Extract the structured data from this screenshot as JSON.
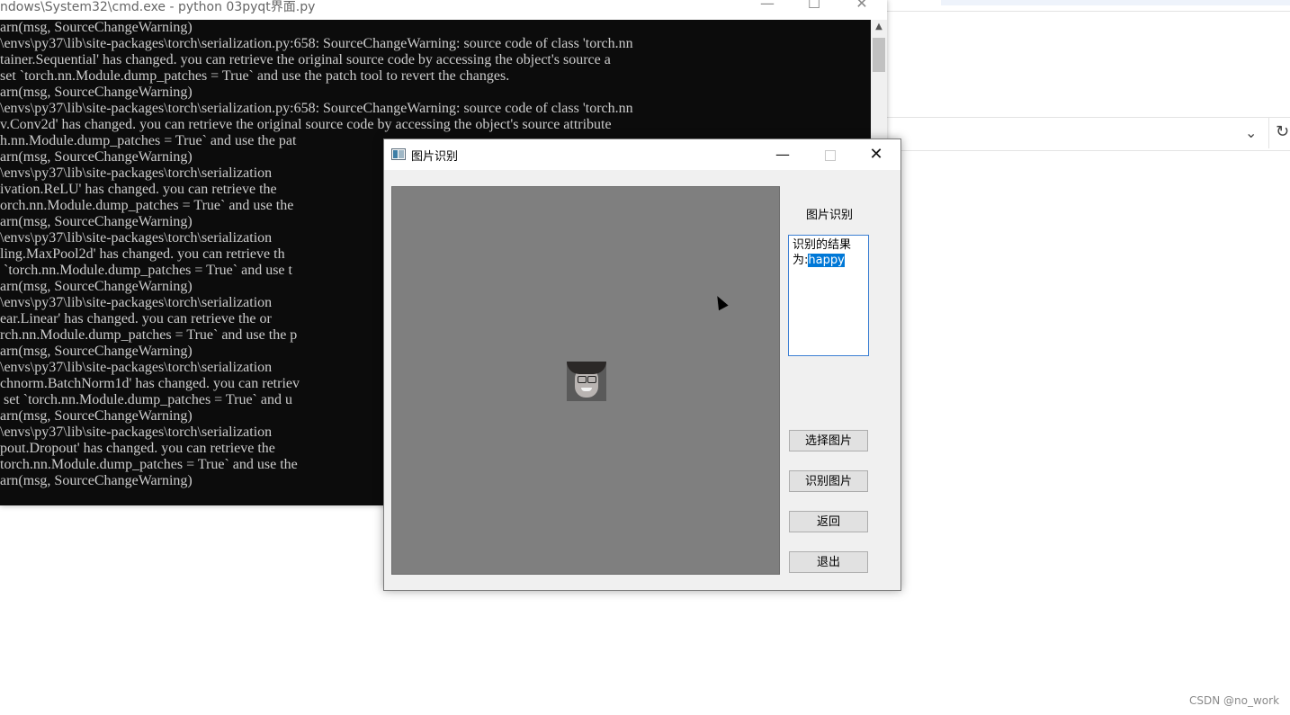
{
  "cmd": {
    "title": "ndows\\System32\\cmd.exe - python  03pyqt界面.py",
    "controls": {
      "minimize": "—",
      "maximize": "☐",
      "close": "✕"
    },
    "lines": [
      "arn(msg, SourceChangeWarning)",
      "\\envs\\py37\\lib\\site-packages\\torch\\serialization.py:658: SourceChangeWarning: source code of class 'torch.nn",
      "tainer.Sequential' has changed. you can retrieve the original source code by accessing the object's source a",
      "set `torch.nn.Module.dump_patches = True` and use the patch tool to revert the changes.",
      "arn(msg, SourceChangeWarning)",
      "\\envs\\py37\\lib\\site-packages\\torch\\serialization.py:658: SourceChangeWarning: source code of class 'torch.nn",
      "v.Conv2d' has changed. you can retrieve the original source code by accessing the object's source attribute",
      "h.nn.Module.dump_patches = True` and use the pat",
      "arn(msg, SourceChangeWarning)",
      "\\envs\\py37\\lib\\site-packages\\torch\\serialization",
      "ivation.ReLU' has changed. you can retrieve the",
      "orch.nn.Module.dump_patches = True` and use the",
      "arn(msg, SourceChangeWarning)",
      "\\envs\\py37\\lib\\site-packages\\torch\\serialization",
      "ling.MaxPool2d' has changed. you can retrieve th",
      " `torch.nn.Module.dump_patches = True` and use t",
      "arn(msg, SourceChangeWarning)",
      "\\envs\\py37\\lib\\site-packages\\torch\\serialization",
      "ear.Linear' has changed. you can retrieve the or",
      "rch.nn.Module.dump_patches = True` and use the p",
      "arn(msg, SourceChangeWarning)",
      "\\envs\\py37\\lib\\site-packages\\torch\\serialization",
      "chnorm.BatchNorm1d' has changed. you can retriev",
      " set `torch.nn.Module.dump_patches = True` and u",
      "arn(msg, SourceChangeWarning)",
      "\\envs\\py37\\lib\\site-packages\\torch\\serialization",
      "pout.Dropout' has changed. you can retrieve the",
      "torch.nn.Module.dump_patches = True` and use the",
      "arn(msg, SourceChangeWarning)"
    ]
  },
  "dialog": {
    "title": "图片识别",
    "controls": {
      "minimize": "—",
      "close": "✕"
    },
    "side_label": "图片识别",
    "result_prefix": "识别的结果为:",
    "result_value": "happy",
    "buttons": {
      "select": "选择图片",
      "recognize": "识别图片",
      "back": "返回",
      "exit": "退出"
    }
  },
  "explorer": {
    "chevron": "⌄",
    "refresh": "↻"
  },
  "watermark": "CSDN @no_work"
}
